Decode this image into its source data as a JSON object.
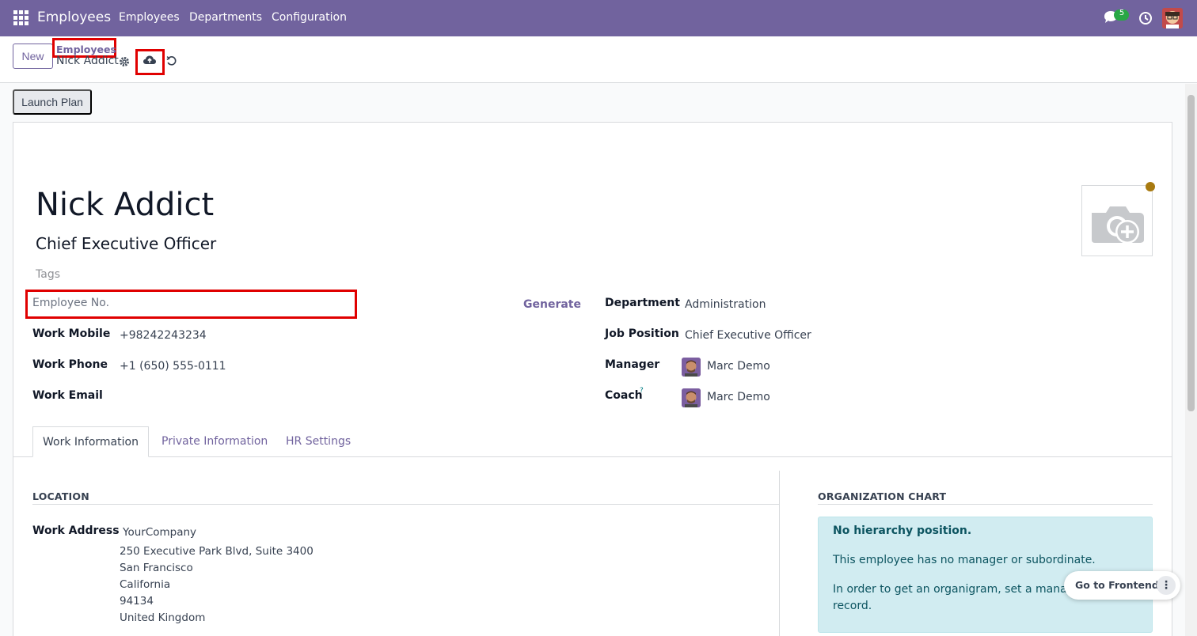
{
  "navbar": {
    "app_title": "Employees",
    "menu": [
      "Employees",
      "Departments",
      "Configuration"
    ],
    "messages_badge": "5",
    "color": "#71639e"
  },
  "control_panel": {
    "new_label": "New",
    "breadcrumb_parent": "Employees",
    "record_name": "Nick Addict"
  },
  "actions": {
    "launch_plan_label": "Launch Plan"
  },
  "employee": {
    "name": "Nick Addict",
    "job_title": "Chief Executive Officer",
    "tags_placeholder": "Tags",
    "employee_no_placeholder": "Employee No.",
    "generate_label": "Generate"
  },
  "fields_left": [
    {
      "label": "Work Mobile",
      "value": "+98242243234"
    },
    {
      "label": "Work Phone",
      "value": "+1 (650) 555-0111"
    },
    {
      "label": "Work Email",
      "value": ""
    }
  ],
  "fields_right": [
    {
      "label": "Department",
      "value": "Administration"
    },
    {
      "label": "Job Position",
      "value": "Chief Executive Officer"
    },
    {
      "label": "Manager",
      "value": "Marc Demo"
    },
    {
      "label": "Coach",
      "value": "Marc Demo",
      "help": "?"
    }
  ],
  "tabs": [
    "Work Information",
    "Private Information",
    "HR Settings"
  ],
  "location": {
    "section_title": "LOCATION",
    "work_address_label": "Work Address",
    "address_lines": [
      "YourCompany",
      "250 Executive Park Blvd, Suite 3400",
      "San Francisco",
      "California",
      "94134",
      "United Kingdom"
    ]
  },
  "org_chart": {
    "section_title": "ORGANIZATION CHART",
    "heading": "No hierarchy position.",
    "text1": "This employee has no manager or subordinate.",
    "text2a": "In order to get an organigram, set a manager a",
    "text2b": "record."
  },
  "frontend": {
    "label": "Go to Frontend"
  }
}
